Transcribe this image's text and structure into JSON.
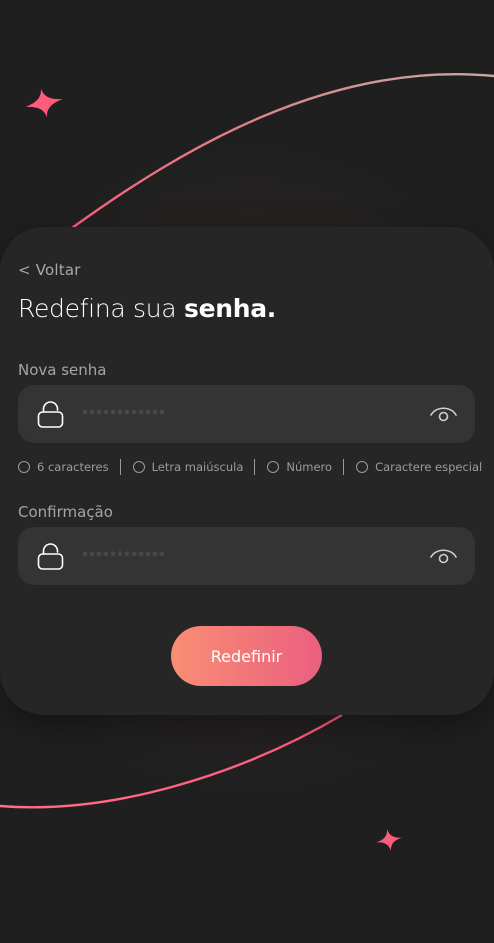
{
  "back_label": "< Voltar",
  "title": {
    "regular": "Redefina sua ",
    "bold": "senha."
  },
  "new_password": {
    "label": "Nova senha",
    "placeholder": "************"
  },
  "requirements": [
    {
      "label": "6 caracteres",
      "checked": false
    },
    {
      "label": "Letra maiúscula",
      "checked": false
    },
    {
      "label": "Número",
      "checked": false
    },
    {
      "label": "Caractere especial",
      "checked": false
    }
  ],
  "confirm_password": {
    "label": "Confirmação",
    "placeholder": "************"
  },
  "submit_label": "Redefinir",
  "icons": {
    "lock": "lock-icon",
    "eye": "eye-icon",
    "sparkle": "sparkle-icon"
  },
  "colors": {
    "background": "#1f1f1f",
    "card": "#262626",
    "field": "#343434",
    "accent_start": "#f98e73",
    "accent_end": "#ea5f7f"
  }
}
